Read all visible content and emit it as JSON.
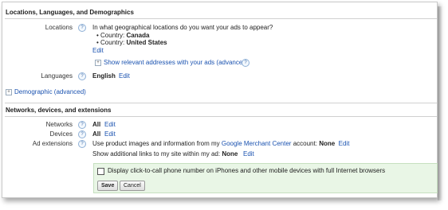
{
  "locations_section": {
    "title": "Locations, Languages, and Demographics",
    "locations_label": "Locations",
    "question": "In what geographical locations do you want your ads to appear?",
    "countries": [
      {
        "prefix": "Country: ",
        "name": "Canada"
      },
      {
        "prefix": "Country: ",
        "name": "United States"
      }
    ],
    "edit": "Edit",
    "show_addresses": "Show relevant addresses with your ads (advanced)",
    "languages_label": "Languages",
    "languages_value": "English",
    "languages_edit": "Edit",
    "demographic": "Demographic (advanced)"
  },
  "networks_section": {
    "title": "Networks, devices, and extensions",
    "networks_label": "Networks",
    "networks_value": "All",
    "networks_edit": "Edit",
    "devices_label": "Devices",
    "devices_value": "All",
    "devices_edit": "Edit",
    "ad_ext_label": "Ad extensions",
    "merchant_prefix": "Use product images and information from my",
    "merchant_link": "Google Merchant Center",
    "merchant_suffix": "account:",
    "merchant_value": "None",
    "merchant_edit": "Edit",
    "sitelinks_prefix": "Show additional links to my site within my ad:",
    "sitelinks_value": "None",
    "sitelinks_edit": "Edit",
    "click_to_call": "Display click-to-call phone number on iPhones and other mobile devices with full Internet browsers",
    "save": "Save",
    "cancel": "Cancel"
  },
  "help_glyph": "?",
  "plus_glyph": "+"
}
